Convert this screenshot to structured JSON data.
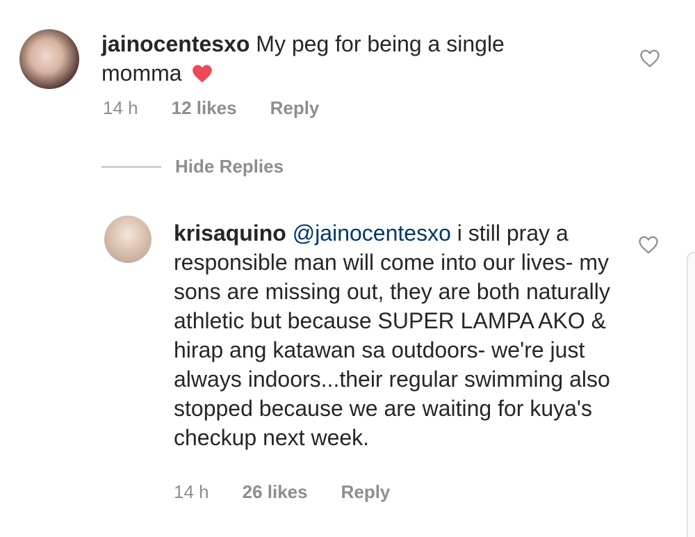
{
  "comments": [
    {
      "username": "jainocentesxo",
      "text": "My peg for being a single momma",
      "time": "14 h",
      "likes": "12 likes",
      "reply_label": "Reply",
      "emoji": "red-heart-icon"
    }
  ],
  "replies_toggle": "Hide Replies",
  "replies": [
    {
      "username": "krisaquino",
      "mention": "@jainocentesxo",
      "text": "i still pray a responsible man will come into our lives- my sons are missing out, they are both naturally athletic but because SUPER LAMPA AKO & hirap ang katawan sa outdoors- we're just always indoors...their regular swimming also stopped because we are waiting for kuya's checkup next week.",
      "time": "14 h",
      "likes": "26 likes",
      "reply_label": "Reply"
    }
  ],
  "colors": {
    "text": "#262626",
    "meta": "#8e8e8e",
    "mention": "#00376b",
    "heart": "#ed4956"
  }
}
